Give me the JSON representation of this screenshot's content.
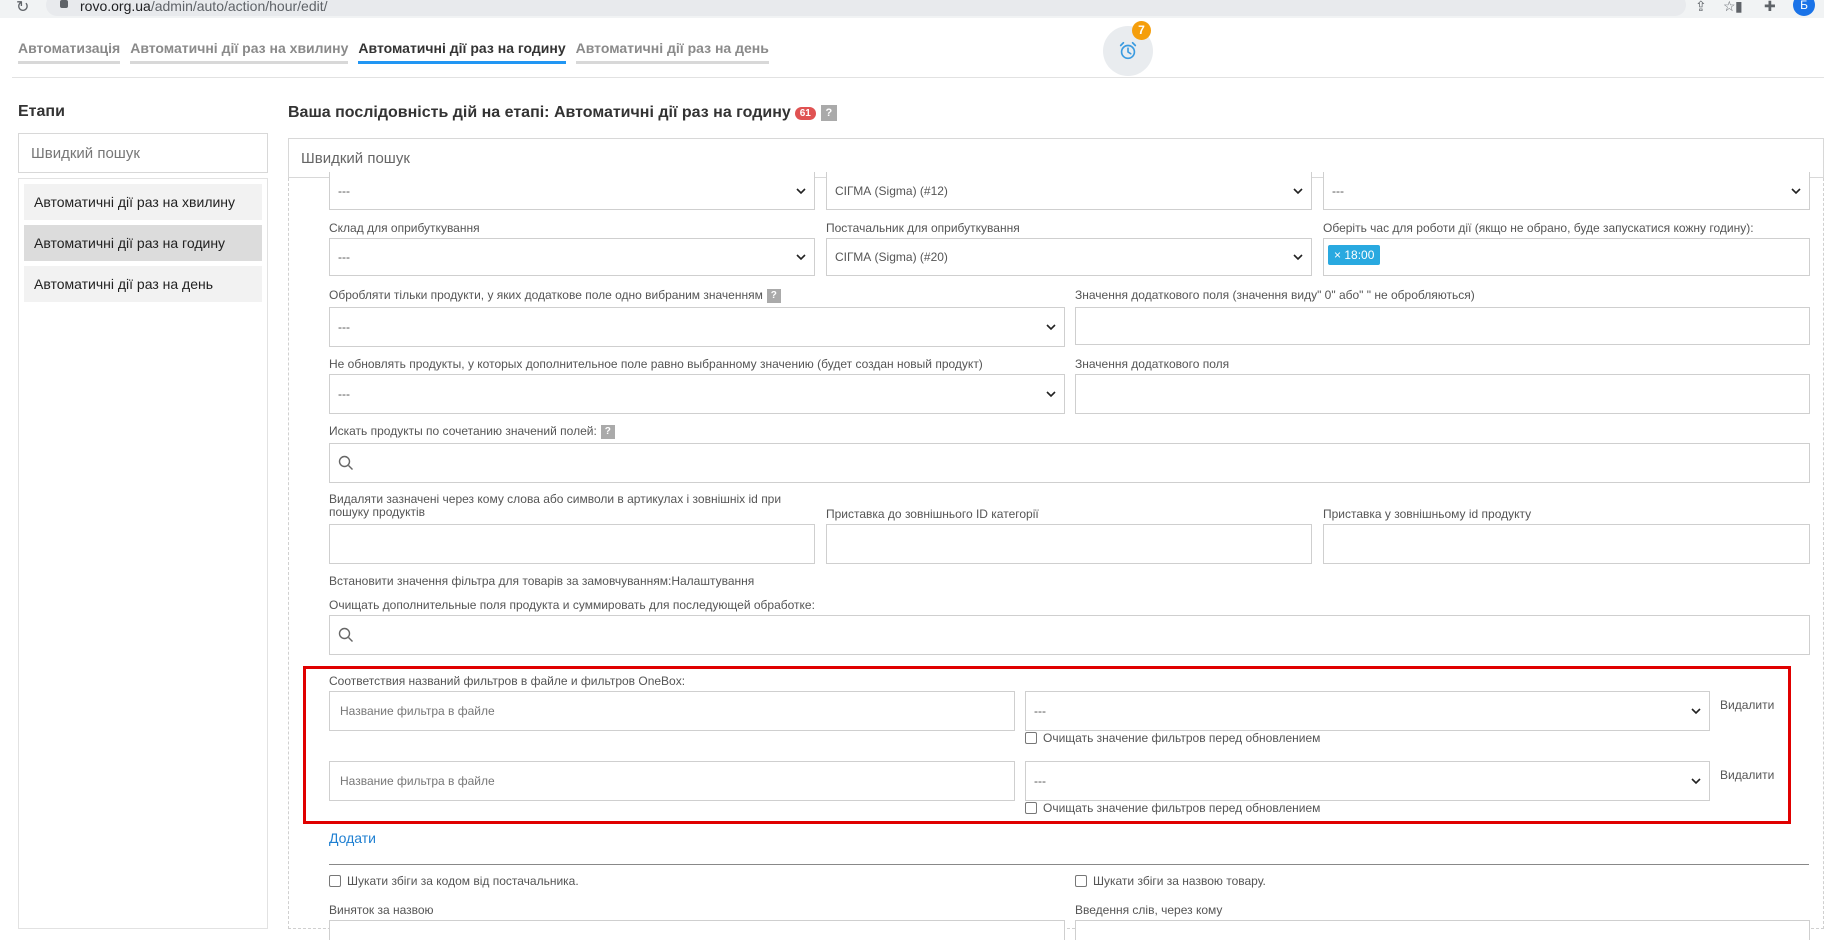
{
  "browser": {
    "url_host": "rovo.org.ua",
    "url_path": "/admin/auto/action/hour/edit/",
    "avatar_letter": "Б"
  },
  "top_tabs": [
    {
      "label": "Автоматизація",
      "active": false
    },
    {
      "label": "Автоматичні дії раз на хвилину",
      "active": false
    },
    {
      "label": "Автоматичні дії раз на годину",
      "active": true
    },
    {
      "label": "Автоматичні дії раз на день",
      "active": false
    }
  ],
  "notifications": {
    "count": "7",
    "icon": "alarm-clock-icon"
  },
  "sidebar": {
    "title": "Етапи",
    "search_placeholder": "Швидкий пошук",
    "items": [
      {
        "label": "Автоматичні дії раз на хвилину",
        "active": false
      },
      {
        "label": "Автоматичні дії раз на годину",
        "active": true
      },
      {
        "label": "Автоматичні дії раз на день",
        "active": false
      }
    ]
  },
  "main": {
    "title": "Ваша послідовність дій на етапі: Автоматичні дії раз на годину",
    "count_badge": "61",
    "help": "?",
    "search_placeholder": "Швидкий пошук"
  },
  "form": {
    "row0": {
      "select1": "---",
      "select2": "СІГМА (Sigma) (#12)",
      "select3": "---"
    },
    "warehouse_label": "Склад для оприбуткування",
    "warehouse_value": "---",
    "supplier_label": "Постачальник для оприбуткування",
    "supplier_value": "СІГМА (Sigma) (#20)",
    "time_label": "Оберіть час для роботи дії (якщо не обрано, буде запускатися кожну годину):",
    "time_tag": "18:00",
    "time_tag_remove": "×",
    "process_only_label": "Обробляти тільки продукти, у яких додаткове поле одно вибраним значенням",
    "process_only_value": "---",
    "extra_field_value_label": "Значення додаткового поля (значення виду\" 0\" або\" \" не обробляються)",
    "not_update_label": "Не обновлять продукты, у которых дополнительное поле равно выбранному значению (будет создан новый продукт)",
    "not_update_value": "---",
    "extra_field_value2_label": "Значення додаткового поля",
    "search_combination_label": "Искать продукты по сочетанию значений полей:",
    "remove_words_label": "Видаляти зазначені через кому слова або символи в артикулах і зовнішніх id при пошуку продуктів",
    "category_prefix_label": "Приставка до зовнішнього ID категорії",
    "product_prefix_label": "Приставка у зовнішньому id продукту",
    "default_filter_label": "Встановити значення фільтра для товарів за замовчуванням:Налаштування",
    "clear_fields_label": "Очищать дополнительные поля продукта и суммировать для последующей обработке:",
    "filter_mapping_label": "Соответствия названий фильтров в файле и фильтров OneBox:",
    "filter_rows": [
      {
        "placeholder": "Название фильтра в файле",
        "select": "---",
        "delete": "Видалити",
        "clear_label": "Очищать значение фильтров перед обновлением"
      },
      {
        "placeholder": "Название фильтра в файле",
        "select": "---",
        "delete": "Видалити",
        "clear_label": "Очищать значение фильтров перед обновлением"
      }
    ],
    "add_label": "Додати",
    "search_by_supplier_code": "Шукати збіги за кодом від постачальника.",
    "search_by_product_name": "Шукати збіги за назвою товару.",
    "exception_by_name_label": "Виняток за назвою",
    "words_input_label": "Введення слів, через кому"
  }
}
